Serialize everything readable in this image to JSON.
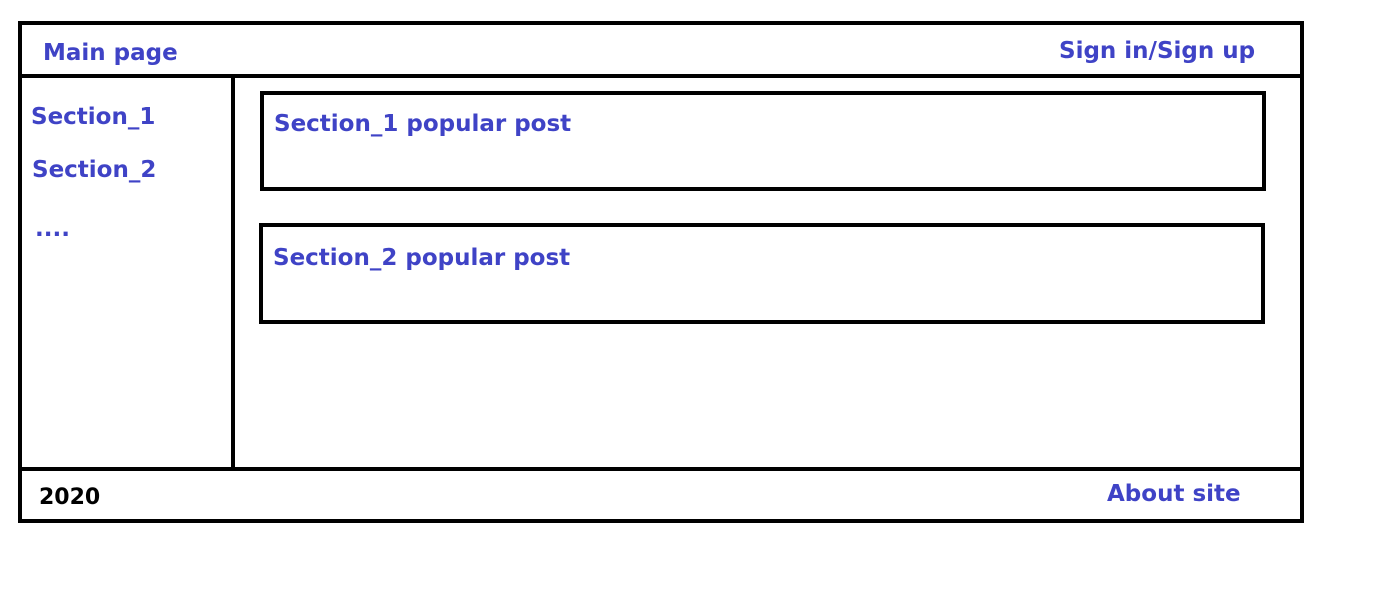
{
  "header": {
    "main_page_label": "Main page",
    "auth_label": "Sign in/Sign up"
  },
  "sidebar": {
    "items": [
      {
        "label": "Section_1"
      },
      {
        "label": "Section_2"
      },
      {
        "label": "...."
      }
    ]
  },
  "main": {
    "posts": [
      {
        "title": "Section_1 popular post"
      },
      {
        "title": "Section_2 popular post"
      }
    ]
  },
  "footer": {
    "year": "2020",
    "about_label": "About site"
  },
  "colors": {
    "link": "#3f43c6",
    "border": "#000000"
  }
}
